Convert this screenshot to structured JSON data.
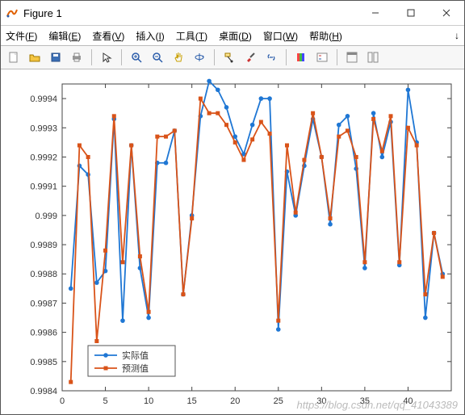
{
  "window": {
    "title": "Figure 1"
  },
  "menus": {
    "file": {
      "label": "文件",
      "hotkey": "F"
    },
    "edit": {
      "label": "编辑",
      "hotkey": "E"
    },
    "view": {
      "label": "查看",
      "hotkey": "V"
    },
    "insert": {
      "label": "插入",
      "hotkey": "I"
    },
    "tools": {
      "label": "工具",
      "hotkey": "T"
    },
    "desktop": {
      "label": "桌面",
      "hotkey": "D"
    },
    "windowm": {
      "label": "窗口",
      "hotkey": "W"
    },
    "help": {
      "label": "帮助",
      "hotkey": "H"
    }
  },
  "toolbar_icons": {
    "new": "new-file-icon",
    "open": "open-folder-icon",
    "save": "save-icon",
    "print": "print-icon",
    "pointer": "pointer-icon",
    "zoomin": "zoom-in-icon",
    "zoomout": "zoom-out-icon",
    "pan": "pan-hand-icon",
    "rotate": "rotate3d-icon",
    "datatip": "data-cursor-icon",
    "brush": "brush-icon",
    "link": "link-plot-icon",
    "colorbar": "colorbar-icon",
    "legend": "legend-icon",
    "docked1": "dock-icon",
    "docked2": "tile-icon"
  },
  "legend": {
    "actual": "实际值",
    "pred": "预测值"
  },
  "watermark": "https://blog.csdn.net/qq_41043389",
  "colors": {
    "actual": "#1f77d4",
    "pred": "#d95319"
  },
  "chart_data": {
    "type": "line",
    "xlabel": "",
    "ylabel": "",
    "title": "",
    "xlim": [
      0,
      45
    ],
    "ylim": [
      0.9984,
      0.99945
    ],
    "xticks": [
      0,
      5,
      10,
      15,
      20,
      25,
      30,
      35,
      40
    ],
    "yticks": [
      0.9984,
      0.9985,
      0.9986,
      0.9987,
      0.9988,
      0.9989,
      0.999,
      0.9991,
      0.9992,
      0.9993,
      0.9994
    ],
    "x": [
      1,
      2,
      3,
      4,
      5,
      6,
      7,
      8,
      9,
      10,
      11,
      12,
      13,
      14,
      15,
      16,
      17,
      18,
      19,
      20,
      21,
      22,
      23,
      24,
      25,
      26,
      27,
      28,
      29,
      30,
      31,
      32,
      33,
      34,
      35,
      36,
      37,
      38,
      39,
      40,
      41,
      42,
      43,
      44
    ],
    "series": [
      {
        "name": "实际值",
        "color": "#1f77d4",
        "values": [
          0.99875,
          0.99917,
          0.99914,
          0.99877,
          0.99881,
          0.99933,
          0.99864,
          0.99924,
          0.99882,
          0.99865,
          0.99918,
          0.99918,
          0.99929,
          0.99873,
          0.999,
          0.99934,
          0.99946,
          0.99943,
          0.99937,
          0.99927,
          0.99921,
          0.99931,
          0.9994,
          0.9994,
          0.99861,
          0.99915,
          0.999,
          0.99917,
          0.99933,
          0.9992,
          0.99897,
          0.99931,
          0.99934,
          0.99916,
          0.99882,
          0.99935,
          0.9992,
          0.99932,
          0.99883,
          0.99943,
          0.99925,
          0.99865,
          0.99894,
          0.9988
        ]
      },
      {
        "name": "预测值",
        "color": "#d95319",
        "values": [
          0.99843,
          0.99924,
          0.9992,
          0.99857,
          0.99888,
          0.99934,
          0.99884,
          0.99924,
          0.99886,
          0.99867,
          0.99927,
          0.99927,
          0.99929,
          0.99873,
          0.99899,
          0.9994,
          0.99935,
          0.99935,
          0.99931,
          0.99925,
          0.99919,
          0.99926,
          0.99932,
          0.99928,
          0.99864,
          0.99924,
          0.99901,
          0.99919,
          0.99935,
          0.9992,
          0.99899,
          0.99927,
          0.99929,
          0.9992,
          0.99884,
          0.99933,
          0.99922,
          0.99934,
          0.99884,
          0.9993,
          0.99924,
          0.99873,
          0.99894,
          0.99879
        ]
      }
    ]
  }
}
